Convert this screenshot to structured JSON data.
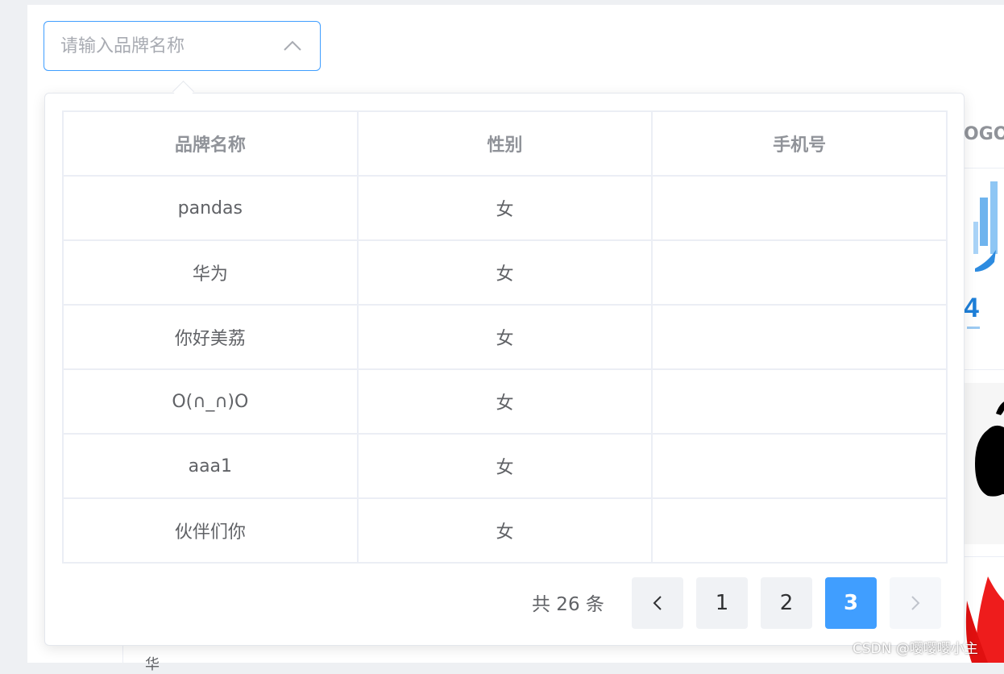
{
  "search": {
    "placeholder": "请输入品牌名称",
    "value": ""
  },
  "table": {
    "headers": [
      "品牌名称",
      "性别",
      "手机号"
    ],
    "rows": [
      {
        "name": "pandas",
        "gender": "女",
        "phone": ""
      },
      {
        "name": "华为",
        "gender": "女",
        "phone": ""
      },
      {
        "name": "你好美荔",
        "gender": "女",
        "phone": ""
      },
      {
        "name": "O(∩_∩)O",
        "gender": "女",
        "phone": ""
      },
      {
        "name": "aaa1",
        "gender": "女",
        "phone": ""
      },
      {
        "name": "伙伴们你",
        "gender": "女",
        "phone": ""
      }
    ]
  },
  "pagination": {
    "total_text": "共 26 条",
    "pages": [
      "1",
      "2",
      "3"
    ],
    "current_page": "3",
    "prev_icon": "chevron-left-icon",
    "next_icon": "chevron-right-icon"
  },
  "background": {
    "column_header_fragment": "OGO",
    "bottom_text_fragment": "华"
  },
  "colors": {
    "accent": "#409eff",
    "border": "#ebeef5",
    "header_text": "#909399",
    "body_text": "#606266"
  },
  "watermark": "CSDN @嘤嘤嘤小主"
}
